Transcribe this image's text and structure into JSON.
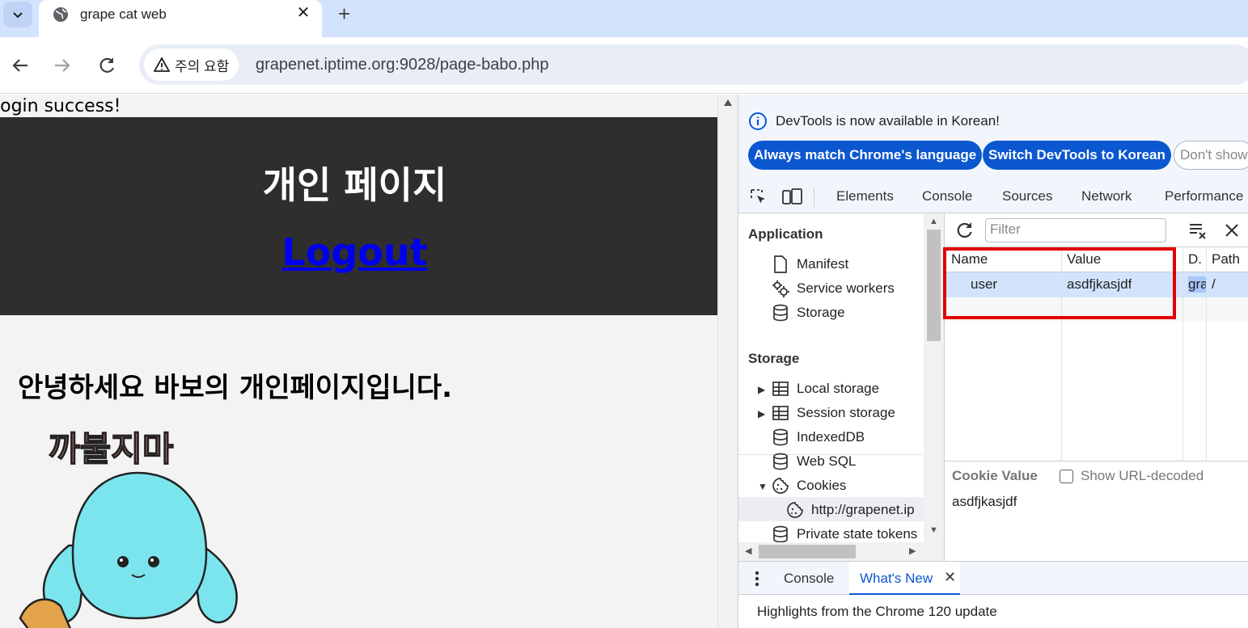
{
  "browser": {
    "tab": {
      "title": "grape cat web",
      "close": "✕"
    },
    "new_tab": "+",
    "security_chip": "주의 요함",
    "url": "grapenet.iptime.org:9028/page-babo.php"
  },
  "page": {
    "login_message": "login success!",
    "hero_title": "개인 페이지",
    "logout_link": "Logout",
    "greeting": "안녕하세요 바보의 개인페이지입니다.",
    "sticker_text": "까불지마"
  },
  "devtools": {
    "notice": {
      "text": "DevTools is now available in Korean!",
      "btn_match": "Always match Chrome's language",
      "btn_switch": "Switch DevTools to Korean",
      "btn_dont": "Don't show"
    },
    "tabs": [
      "Elements",
      "Console",
      "Sources",
      "Network",
      "Performance"
    ],
    "sidebar": {
      "application_heading": "Application",
      "application_items": [
        "Manifest",
        "Service workers",
        "Storage"
      ],
      "storage_heading": "Storage",
      "storage_items": [
        "Local storage",
        "Session storage",
        "IndexedDB",
        "Web SQL",
        "Cookies",
        "http://grapenet.ip",
        "Private state tokens"
      ]
    },
    "cookies": {
      "filter_placeholder": "Filter",
      "columns": [
        "Name",
        "Value",
        "D.",
        "Path"
      ],
      "rows": [
        {
          "name": "user",
          "value": "asdfjkasjdf",
          "domain": "gra",
          "path": "/"
        }
      ],
      "cookie_value_label": "Cookie Value",
      "show_decoded_label": "Show URL-decoded",
      "cookie_value": "asdfjkasjdf"
    },
    "drawer": {
      "tabs": [
        "Console",
        "What's New"
      ],
      "close": "✕",
      "content": "Highlights from the Chrome 120 update"
    }
  },
  "colors": {
    "tabstrip": "#d3e3fd",
    "hero_bg": "#2e2e2e",
    "link": "#0000ee",
    "devtools_accent": "#0b57d0",
    "highlight_box": "#e00000",
    "sticker_blue": "#7be5ee"
  }
}
